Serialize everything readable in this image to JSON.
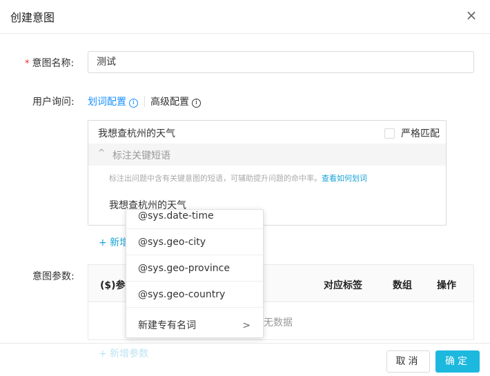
{
  "dialog": {
    "title": "创建意图",
    "close_icon": "×"
  },
  "form": {
    "intent_name": {
      "label": "意图名称:",
      "required_mark": "*",
      "value": "测试"
    },
    "user_query": {
      "label": "用户询问:",
      "tabs": [
        {
          "label": "划词配置",
          "info": "i"
        },
        {
          "label": "高级配置",
          "info": "i"
        }
      ],
      "query_text": "我想查杭州的天气",
      "strict_match": {
        "label": "严格匹配",
        "checked": false
      },
      "keyword_panel": {
        "chevron": "^",
        "title": "标注关键短语",
        "hint": "标注出问题中含有关键意图的短语，可辅助提升问题的命中率。",
        "hint_link": "查看如何划词",
        "annotated_text": "我想查杭州的天气"
      },
      "add_link": "+ 新增"
    },
    "intent_params": {
      "label": "意图参数:",
      "columns": [
        "($)参数",
        "对应标签",
        "数组",
        "操作"
      ],
      "empty_text": "暂无数据",
      "add_link": "+ 新增参数"
    }
  },
  "dropdown": {
    "items": [
      "@sys.date-time",
      "@sys.geo-city",
      "@sys.geo-province",
      "@sys.geo-country"
    ],
    "new_entity": "新建专有名词",
    "arrow": ">"
  },
  "footer": {
    "cancel_label": "取消",
    "ok_label": "确定"
  },
  "colors": {
    "primary": "#1cb8de",
    "link": "#1aa3d6",
    "tab_active": "#1890ff",
    "required": "#f5222d"
  }
}
